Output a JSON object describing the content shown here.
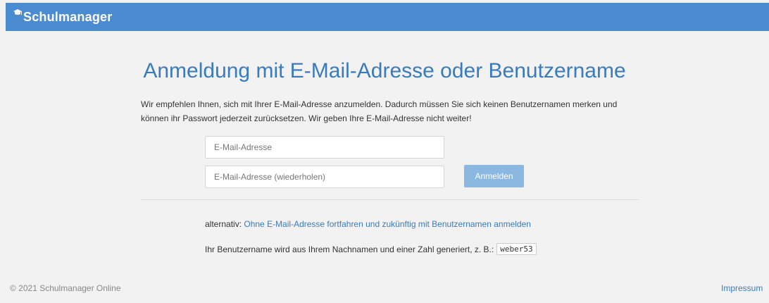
{
  "header": {
    "brand": "Schulmanager",
    "brand_icon": "graduation-cap-icon",
    "background_color": "#4a8ccf"
  },
  "main": {
    "title": "Anmeldung mit E-Mail-Adresse oder Benutzername",
    "intro": "Wir empfehlen Ihnen, sich mit Ihrer E-Mail-Adresse anzumelden. Dadurch müssen Sie sich keinen Benutzernamen merken und können ihr Passwort jederzeit zurücksetzen. Wir geben Ihre E-Mail-Adresse nicht weiter!",
    "email": {
      "value": "",
      "placeholder": "E-Mail-Adresse"
    },
    "email_repeat": {
      "value": "",
      "placeholder": "E-Mail-Adresse (wiederholen)"
    },
    "submit_label": "Anmelden",
    "alternative_prefix": "alternativ:",
    "alternative_link": "Ohne E-Mail-Adresse fortfahren und zukünftig mit Benutzernamen anmelden",
    "username_hint": "Ihr Benutzername wird aus Ihrem Nachnamen und einer Zahl generiert, z. B.:",
    "username_example": "weber53"
  },
  "footer": {
    "copyright": "© 2021 Schulmanager Online",
    "imprint": "Impressum"
  },
  "colors": {
    "accent": "#3a7bbd",
    "button": "#8bb8e0",
    "page_background": "#f2f2f2"
  }
}
